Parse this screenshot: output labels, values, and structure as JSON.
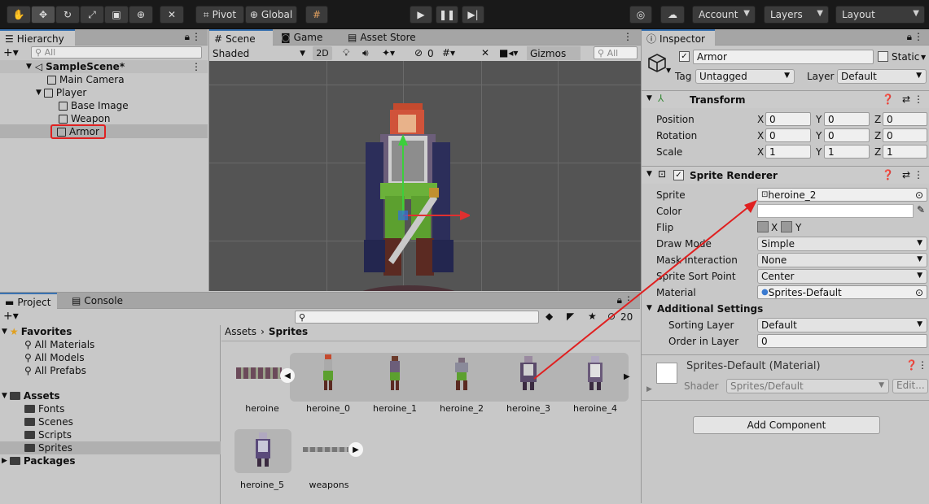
{
  "toolbar": {
    "pivot_label": "Pivot",
    "global_label": "Global",
    "account_label": "Account",
    "layers_label": "Layers",
    "layout_label": "Layout"
  },
  "hierarchy": {
    "tab_label": "Hierarchy",
    "search_placeholder": "All",
    "scene_name": "SampleScene*",
    "items": [
      {
        "label": "Main Camera"
      },
      {
        "label": "Player"
      },
      {
        "label": "Base Image"
      },
      {
        "label": "Weapon"
      },
      {
        "label": "Armor"
      }
    ]
  },
  "scene_view": {
    "tabs": [
      {
        "label": "Scene"
      },
      {
        "label": "Game"
      },
      {
        "label": "Asset Store"
      }
    ],
    "shading_mode": "Shaded",
    "mode_2d": "2D",
    "hidden_count": "0",
    "gizmos_label": "Gizmos",
    "search_placeholder": "All"
  },
  "project": {
    "tabs": [
      {
        "label": "Project"
      },
      {
        "label": "Console"
      }
    ],
    "count_label": "20",
    "favorites_label": "Favorites",
    "favorites": [
      {
        "label": "All Materials"
      },
      {
        "label": "All Models"
      },
      {
        "label": "All Prefabs"
      }
    ],
    "assets_label": "Assets",
    "asset_folders": [
      {
        "label": "Fonts"
      },
      {
        "label": "Scenes"
      },
      {
        "label": "Scripts"
      },
      {
        "label": "Sprites"
      }
    ],
    "packages_label": "Packages",
    "breadcrumb_root": "Assets",
    "breadcrumb_current": "Sprites",
    "sprites": [
      {
        "label": "heroine"
      },
      {
        "label": "heroine_0"
      },
      {
        "label": "heroine_1"
      },
      {
        "label": "heroine_2"
      },
      {
        "label": "heroine_3"
      },
      {
        "label": "heroine_4"
      },
      {
        "label": "heroine_5"
      },
      {
        "label": "weapons"
      }
    ]
  },
  "inspector": {
    "tab_label": "Inspector",
    "object_name": "Armor",
    "static_label": "Static",
    "tag_label": "Tag",
    "tag_value": "Untagged",
    "layer_label": "Layer",
    "layer_value": "Default",
    "transform": {
      "title": "Transform",
      "position_label": "Position",
      "rotation_label": "Rotation",
      "scale_label": "Scale",
      "position": {
        "x": "0",
        "y": "0",
        "z": "0"
      },
      "rotation": {
        "x": "0",
        "y": "0",
        "z": "0"
      },
      "scale": {
        "x": "1",
        "y": "1",
        "z": "1"
      }
    },
    "sprite_renderer": {
      "title": "Sprite Renderer",
      "sprite_label": "Sprite",
      "sprite_value": "heroine_2",
      "color_label": "Color",
      "color_value": "#ffffff",
      "flip_label": "Flip",
      "flip_x": "X",
      "flip_y": "Y",
      "draw_mode_label": "Draw Mode",
      "draw_mode_value": "Simple",
      "mask_label": "Mask Interaction",
      "mask_value": "None",
      "sort_point_label": "Sprite Sort Point",
      "sort_point_value": "Center",
      "material_label": "Material",
      "material_value": "Sprites-Default",
      "additional_label": "Additional Settings",
      "sorting_layer_label": "Sorting Layer",
      "sorting_layer_value": "Default",
      "order_label": "Order in Layer",
      "order_value": "0"
    },
    "material": {
      "title": "Sprites-Default (Material)",
      "shader_label": "Shader",
      "shader_value": "Sprites/Default",
      "edit_label": "Edit..."
    },
    "add_component_label": "Add Component"
  },
  "colors": {
    "accent_red": "#e02020",
    "selection": "#b0b0b0"
  }
}
